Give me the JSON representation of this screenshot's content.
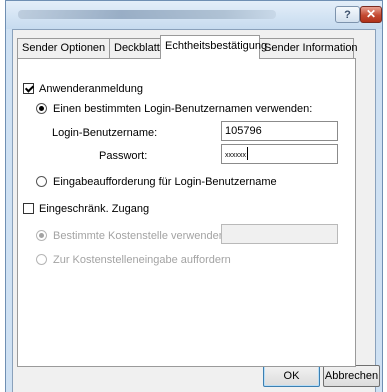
{
  "window": {
    "help_glyph": "?",
    "close_glyph": "✕"
  },
  "tabs": [
    {
      "label": "Sender Optionen"
    },
    {
      "label": "Deckblatt"
    },
    {
      "label": "Echtheitsbestätigung"
    },
    {
      "label": "Sender Information"
    }
  ],
  "user_login": {
    "checkbox_label": "Anwenderanmeldung",
    "checked": true,
    "radio_specific_label": "Einen bestimmten Login-Benutzernamen verwenden:",
    "username_label": "Login-Benutzername:",
    "username_value": "105796",
    "password_label": "Passwort:",
    "password_value": "xxxxxx",
    "radio_prompt_label": "Eingabeaufforderung für Login-Benutzername"
  },
  "restricted_access": {
    "checkbox_label": "Eingeschränk. Zugang",
    "checked": false,
    "radio_account_label": "Bestimmte Kostenstelle verwenden:",
    "account_value": "",
    "radio_prompt_label": "Zur Kostenstelleneingabe auffordern"
  },
  "buttons": {
    "ok": "OK",
    "cancel": "Abbrechen"
  }
}
